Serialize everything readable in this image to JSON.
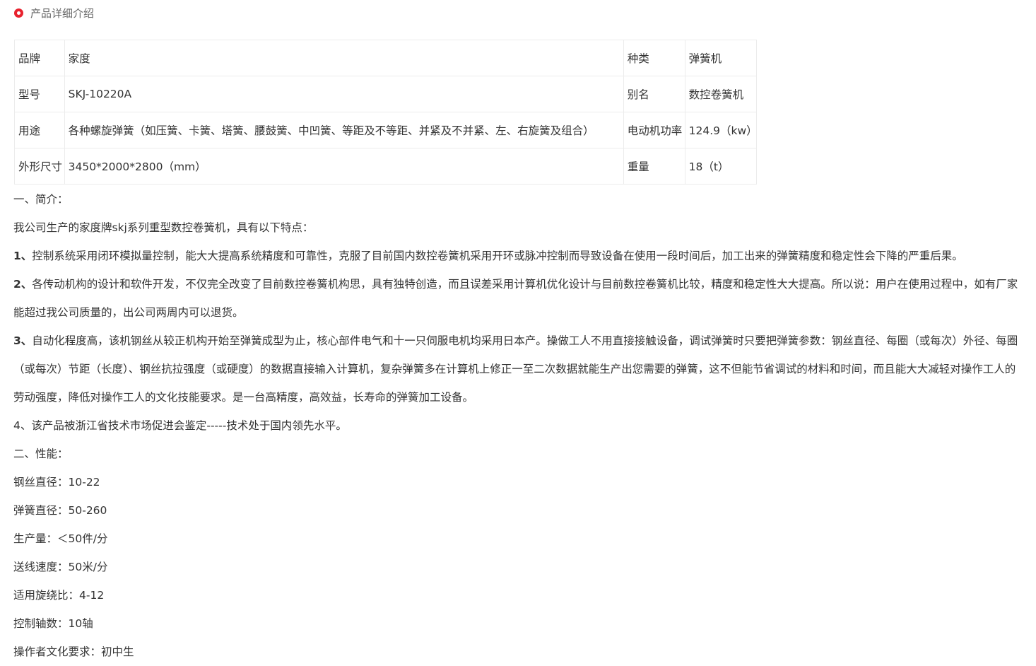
{
  "section": {
    "title": "产品详细介绍"
  },
  "spec_table": [
    [
      "品牌",
      "家度",
      "种类",
      "弹簧机"
    ],
    [
      "型号",
      "SKJ-10220A",
      "别名",
      "数控卷簧机"
    ],
    [
      "用途",
      "各种螺旋弹簧（如压簧、卡簧、塔簧、腰鼓簧、中凹簧、等距及不等距、并紧及不并紧、左、右旋簧及组合）",
      "电动机功率",
      "124.9（kw）"
    ],
    [
      "外形尺寸",
      "3450*2000*2800（mm）",
      "重量",
      "18（t）"
    ]
  ],
  "content": {
    "intro_heading": "一、简介：",
    "intro_line": "我公司生产的家度牌skj系列重型数控卷簧机，具有以下特点：",
    "p1_num": "1、",
    "p1_text": "控制系统采用闭环模拟量控制，能大大提高系统精度和可靠性，克服了目前国内数控卷簧机采用开环或脉冲控制而导致设备在使用一段时间后，加工出来的弹簧精度和稳定性会下降的严重后果。",
    "p2_num": "2、",
    "p2_text": "各传动机构的设计和软件开发，不仅完全改变了目前数控卷簧机构思，具有独特创造，而且误差采用计算机优化设计与目前数控卷簧机比较，精度和稳定性大大提高。所以说：用户在使用过程中，如有厂家能超过我公司质量的，出公司两周内可以退货。",
    "p3_num": "3、",
    "p3_text": "自动化程度高，该机钢丝从较正机构开始至弹簧成型为止，核心部件电气和十一只伺服电机均采用日本产。操做工人不用直接接触设备，调试弹簧时只要把弹簧参数：钢丝直径、每圈（或每次）外径、每圈（或每次）节距（长度）、钢丝抗拉强度（或硬度）的数据直接输入计算机，复杂弹簧多在计算机上修正一至二次数据就能生产出您需要的弹簧，这不但能节省调试的材料和时间，而且能大大减轻对操作工人的劳动强度，降低对操作工人的文化技能要求。是一台高精度，高效益，长寿命的弹簧加工设备。",
    "p4": "4、该产品被浙江省技术市场促进会鉴定-----技术处于国内领先水平。",
    "perf_heading": "二、性能：",
    "perf_items": [
      "钢丝直径：10-22",
      "弹簧直径：50-260",
      "生产量：＜50件/分",
      "送线速度：50米/分",
      "适用旋绕比：4-12",
      "控制轴数：10轴",
      "操作者文化要求：初中生"
    ]
  }
}
